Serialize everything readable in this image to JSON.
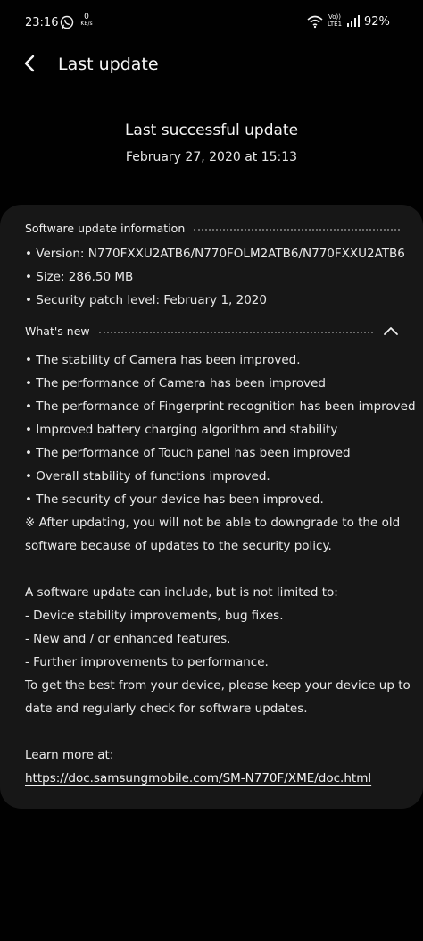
{
  "status_bar": {
    "time": "23:16",
    "net_speed_value": "0",
    "net_speed_unit": "KB/s",
    "volte_top": "Vo))",
    "volte_bottom": "LTE1",
    "battery": "92%",
    "icons": [
      "whatsapp-icon",
      "wifi-icon",
      "signal-icon"
    ]
  },
  "header": {
    "title": "Last update"
  },
  "summary": {
    "title": "Last successful update",
    "date": "February 27, 2020 at 15:13"
  },
  "software_info": {
    "heading": "Software update information",
    "items": [
      "• Version: N770FXXU2ATB6/N770FOLM2ATB6/N770FXXU2ATB6",
      "• Size: 286.50 MB",
      "• Security patch level: February 1, 2020"
    ]
  },
  "whats_new": {
    "heading": "What's new",
    "items": [
      "• The stability of Camera has been improved.",
      "• The performance of Camera has been improved",
      "• The performance of Fingerprint recognition has been improved",
      "• Improved battery charging algorithm and stability",
      "• The performance of Touch panel has been improved",
      "• Overall stability of functions improved.",
      "• The security of your device has been improved.",
      "※ After updating, you will not be able to downgrade to the old",
      "software because of updates to the security policy.",
      "",
      "A software update can include, but is not limited to:",
      " - Device stability improvements, bug fixes.",
      " - New and / or enhanced features.",
      " - Further improvements to performance.",
      "To get the best from your device, please keep your device up to",
      "date and regularly check for software updates.",
      "",
      "Learn more at:"
    ],
    "link": "https://doc.samsungmobile.com/SM-N770F/XME/doc.html"
  },
  "colors": {
    "background": "#010101",
    "card": "#171717",
    "text": "#e9e9e9"
  }
}
